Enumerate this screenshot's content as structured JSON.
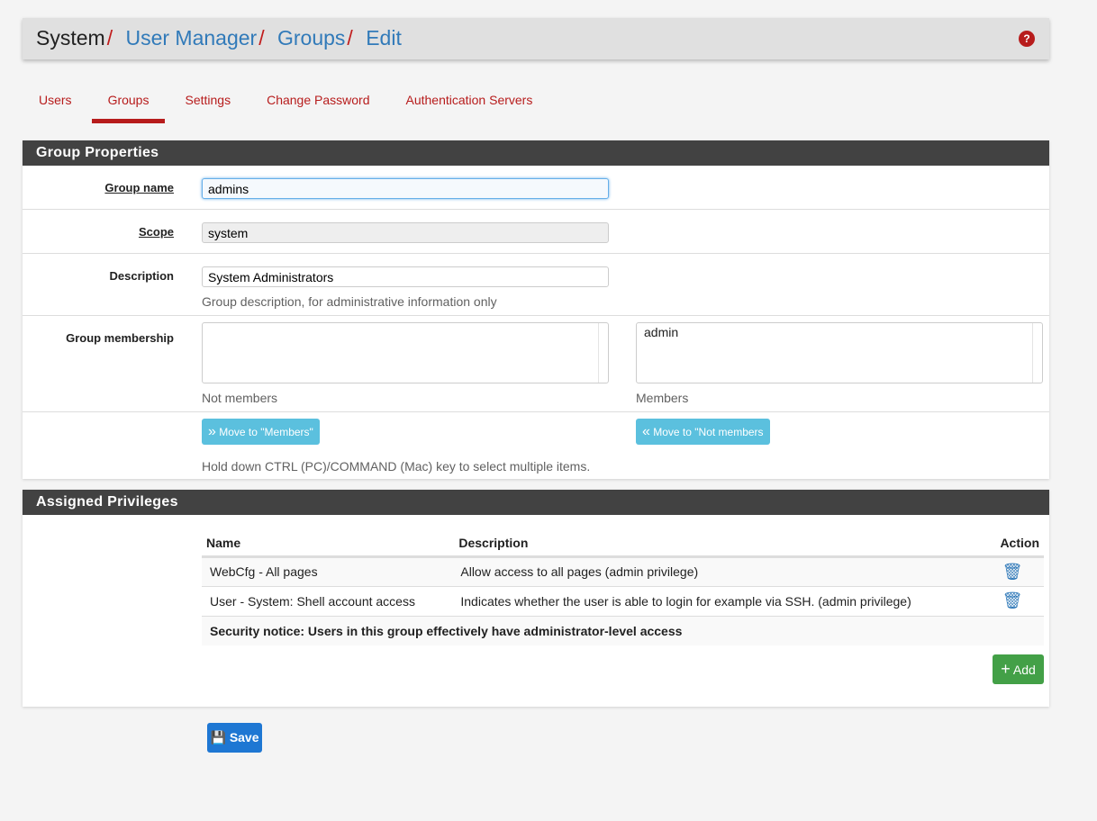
{
  "breadcrumb": {
    "root": "System",
    "items": [
      "User Manager",
      "Groups",
      "Edit"
    ],
    "separator": "/"
  },
  "help_icon": "?",
  "tabs": [
    {
      "label": "Users"
    },
    {
      "label": "Groups",
      "active": true
    },
    {
      "label": "Settings"
    },
    {
      "label": "Change Password"
    },
    {
      "label": "Authentication Servers"
    }
  ],
  "group_properties": {
    "title": "Group Properties",
    "group_name": {
      "label": "Group name",
      "value": "admins"
    },
    "scope": {
      "label": "Scope",
      "value": "system"
    },
    "description": {
      "label": "Description",
      "value": "System Administrators",
      "hint": "Group description, for administrative information only"
    },
    "membership": {
      "label": "Group membership",
      "not_members_label": "Not members",
      "members_label": "Members",
      "members": [
        "admin"
      ],
      "not_members": []
    },
    "move_to_members": "Move to \"Members\"",
    "move_to_not_members": "Move to \"Not members",
    "multi_hint": "Hold down CTRL (PC)/COMMAND (Mac) key to select multiple items."
  },
  "privileges": {
    "title": "Assigned Privileges",
    "columns": [
      "Name",
      "Description",
      "Action"
    ],
    "rows": [
      {
        "name": "WebCfg - All pages",
        "description": "Allow access to all pages (admin privilege)"
      },
      {
        "name": "User - System: Shell account access",
        "description": "Indicates whether the user is able to login for example via SSH. (admin privilege)"
      }
    ],
    "notice": "Security notice: Users in this group effectively have administrator-level access",
    "add_label": "Add"
  },
  "save_label": "Save",
  "colors": {
    "accent_red": "#b71c1c",
    "link_blue": "#317ab9",
    "info": "#5bc0de",
    "success": "#43a047",
    "primary": "#1e77d3"
  }
}
